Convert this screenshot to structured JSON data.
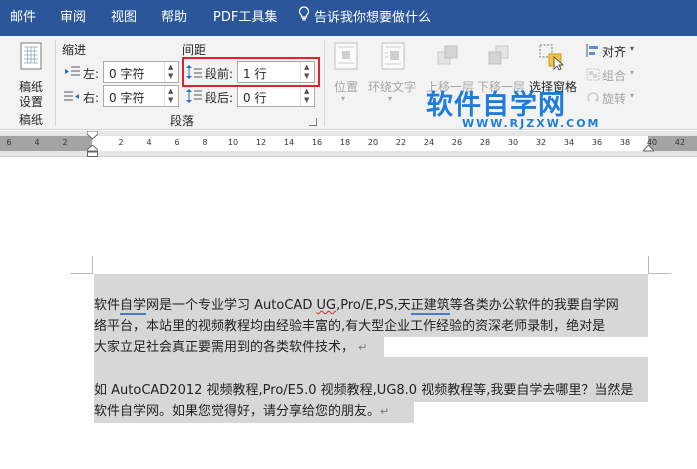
{
  "tabs": [
    "邮件",
    "审阅",
    "视图",
    "帮助",
    "PDF工具集"
  ],
  "tell_me": "告诉我你想要做什么",
  "ribbon": {
    "manuscript_button": [
      "稿纸",
      "设置"
    ],
    "manuscript_group": "稿纸",
    "indent": {
      "title": "缩进",
      "left_label": "左:",
      "left_value": "0 字符",
      "right_label": "右:",
      "right_value": "0 字符"
    },
    "spacing": {
      "title": "间距",
      "before_label": "段前:",
      "before_value": "1 行",
      "after_label": "段后:",
      "after_value": "0 行"
    },
    "paragraph_group": "段落",
    "arrange": {
      "position": "位置",
      "wrap_text": "环绕文字",
      "bring_forward": "上移一层",
      "send_backward": "下移一层",
      "selection_pane": "选择窗格",
      "align": "对齐",
      "group": "组合",
      "rotate": "旋转"
    }
  },
  "watermark": {
    "title": "软件自学网",
    "url": "WWW.RJZXW.COM"
  },
  "ruler_labels": [
    "6",
    "4",
    "2",
    "2",
    "4",
    "6",
    "8",
    "10",
    "12",
    "14",
    "16",
    "18",
    "20",
    "22",
    "24",
    "26",
    "28",
    "30",
    "32",
    "34",
    "36",
    "38",
    "40",
    "42"
  ],
  "document": {
    "para1": {
      "line1_a": "软件",
      "line1_b": "自学",
      "line1_c": "网是一个专业学习 AutoCAD ",
      "line1_d": "UG",
      "line1_e": ",Pro/E,PS,天",
      "line1_f": "正建筑",
      "line1_g": "等各类办公软件的我要自学网",
      "line2": "络平台，本站里的视频教程均由经验丰富的,有大型企业工作经验的资深老师录制，绝对是",
      "line3": "大家立足社会真正要需用到的各类软件技术，"
    },
    "para2": {
      "line1": "如 AutoCAD2012 视频教程,Pro/E5.0 视频教程,UG8.0 视频教程等,我要自学去哪里？当然是",
      "line2": "软件自学网。如果您觉得好，请分享给您的朋友。"
    },
    "paragraph_mark": "↵"
  }
}
